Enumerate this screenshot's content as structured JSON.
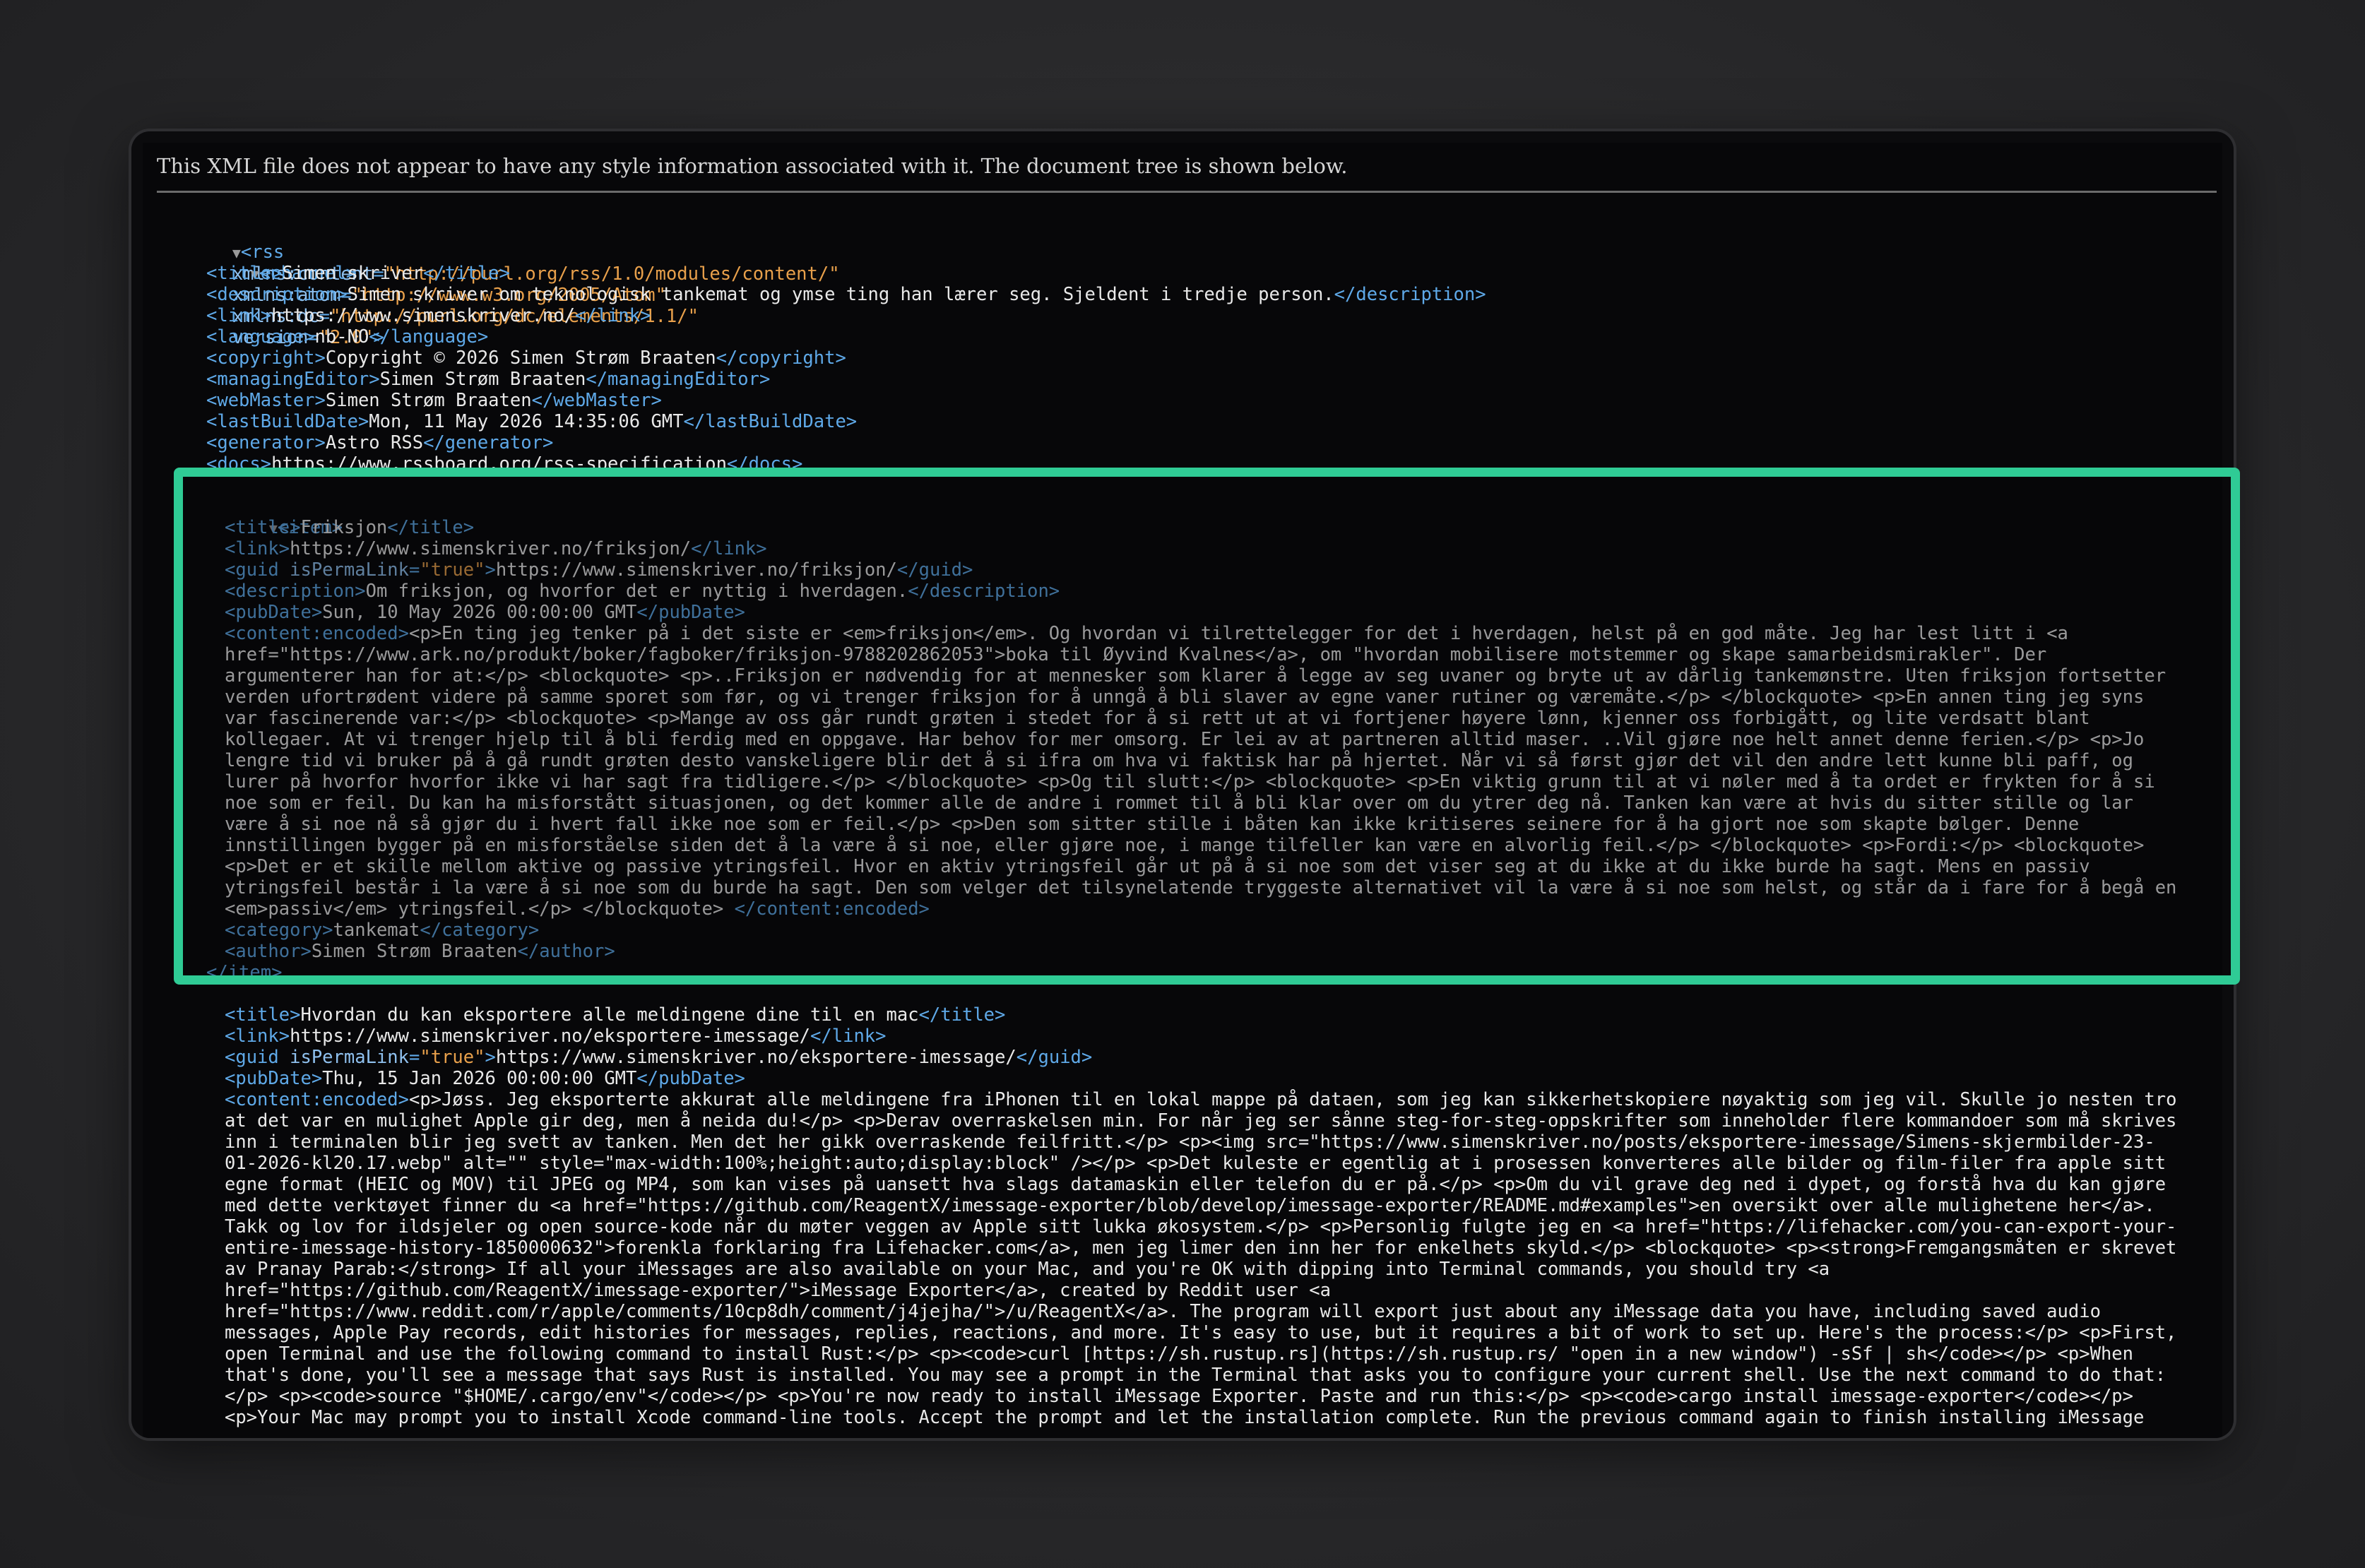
{
  "notice": "This XML file does not appear to have any style information associated with it. The document tree is shown below.",
  "rss": {
    "open_tag": "<rss",
    "attrs": [
      {
        "name": "xmlns:content",
        "value": "\"http://purl.org/rss/1.0/modules/content/\""
      },
      {
        "name": "xmlns:atom",
        "value": "\"http://www.w3.org/2005/Atom\""
      },
      {
        "name": "xmlns:dc",
        "value": "\"http://purl.org/dc/elements/1.1/\""
      },
      {
        "name": "version",
        "value": "\"2.0\""
      }
    ],
    "close": ">"
  },
  "channel_tag": "<channel>",
  "channel": [
    {
      "open": "<title>",
      "text": "Simen skriver",
      "close": "</title>"
    },
    {
      "open": "<description>",
      "text": "Simen skriver om teknologisk tankemat og ymse ting han lærer seg. Sjeldent i tredje person.",
      "close": "</description>"
    },
    {
      "open": "<link>",
      "text": "https://www.simenskriver.no/",
      "close": "</link>"
    },
    {
      "open": "<language>",
      "text": "nb-NO",
      "close": "</language>"
    },
    {
      "open": "<copyright>",
      "text": "Copyright © 2026 Simen Strøm Braaten",
      "close": "</copyright>"
    },
    {
      "open": "<managingEditor>",
      "text": "Simen Strøm Braaten",
      "close": "</managingEditor>"
    },
    {
      "open": "<webMaster>",
      "text": "Simen Strøm Braaten",
      "close": "</webMaster>"
    },
    {
      "open": "<lastBuildDate>",
      "text": "Mon, 11 May 2026 14:35:06 GMT",
      "close": "</lastBuildDate>"
    },
    {
      "open": "<generator>",
      "text": "Astro RSS",
      "close": "</generator>"
    },
    {
      "open": "<docs>",
      "text": "https://www.rssboard.org/rss-specification",
      "close": "</docs>"
    }
  ],
  "item1": {
    "open_tag": "<item>",
    "close_tag": "</item>",
    "title": {
      "open": "<title>",
      "text": "Friksjon",
      "close": "</title>"
    },
    "link": {
      "open": "<link>",
      "text": "https://www.simenskriver.no/friksjon/",
      "close": "</link>"
    },
    "guid": {
      "open": "<guid",
      "attr": "isPermaLink",
      "attr_value": "\"true\"",
      "open_end": ">",
      "text": "https://www.simenskriver.no/friksjon/",
      "close": "</guid>"
    },
    "description": {
      "open": "<description>",
      "text": "Om friksjon, og hvorfor det er nyttig i hverdagen.",
      "close": "</description>"
    },
    "pubDate": {
      "open": "<pubDate>",
      "text": "Sun, 10 May 2026 00:00:00 GMT",
      "close": "</pubDate>"
    },
    "content_open": "<content:encoded>",
    "content_close": "</content:encoded>",
    "content_lines": [
      "<p>En ting jeg tenker på i det siste er <em>friksjon</em>. Og hvordan vi tilrettelegger for det i hverdagen, helst på en god måte. Jeg har lest litt i <a",
      "href=\"https://www.ark.no/produkt/boker/fagboker/friksjon-9788202862053\">boka til Øyvind Kvalnes</a>, om \"hvordan mobilisere motstemmer og skape samarbeidsmirakler\". Der",
      "argumenterer han for at:</p> <blockquote> <p>..Friksjon er nødvendig for at mennesker som klarer å legge av seg uvaner og bryte ut av dårlig tankemønstre. Uten friksjon fortsetter",
      "verden ufortrødent videre på samme sporet som før, og vi trenger friksjon for å unngå å bli slaver av egne vaner rutiner og væremåte.</p> </blockquote> <p>En annen ting jeg syns",
      "var fascinerende var:</p> <blockquote> <p>Mange av oss går rundt grøten i stedet for å si rett ut at vi fortjener høyere lønn, kjenner oss forbigått, og lite verdsatt blant",
      "kollegaer. At vi trenger hjelp til å bli ferdig med en oppgave. Har behov for mer omsorg. Er lei av at partneren alltid maser. ..Vil gjøre noe helt annet denne ferien.</p> <p>Jo",
      "lengre tid vi bruker på å gå rundt grøten desto vanskeligere blir det å si ifra om hva vi faktisk har på hjertet. Når vi så først gjør det vil den andre lett kunne bli paff, og",
      "lurer på hvorfor hvorfor ikke vi har sagt fra tidligere.</p> </blockquote> <p>Og til slutt:</p> <blockquote> <p>En viktig grunn til at vi nøler med å ta ordet er frykten for å si",
      "noe som er feil. Du kan ha misforstått situasjonen, og det kommer alle de andre i rommet til å bli klar over om du ytrer deg nå. Tanken kan være at hvis du sitter stille og lar",
      "være å si noe nå så gjør du i hvert fall ikke noe som er feil.</p> <p>Den som sitter stille i båten kan ikke kritiseres seinere for å ha gjort noe som skapte bølger. Denne",
      "innstillingen bygger på en misforståelse siden det å la være å si noe, eller gjøre noe, i mange tilfeller kan være en alvorlig feil.</p> </blockquote> <p>Fordi:</p> <blockquote>",
      "<p>Det er et skille mellom aktive og passive ytringsfeil. Hvor en aktiv ytringsfeil går ut på å si noe som det viser seg at du ikke at du ikke burde ha sagt. Mens en passiv",
      "ytringsfeil består i la være å si noe som du burde ha sagt. Den som velger det tilsynelatende tryggeste alternativet vil la være å si noe som helst, og står da i fare for å begå en",
      "<em>passiv</em> ytringsfeil.</p> </blockquote> "
    ],
    "category": {
      "open": "<category>",
      "text": "tankemat",
      "close": "</category>"
    },
    "author": {
      "open": "<author>",
      "text": "Simen Strøm Braaten",
      "close": "</author>"
    }
  },
  "item2": {
    "title": {
      "open": "<title>",
      "text": "Hvordan du kan eksportere alle meldingene dine til en mac",
      "close": "</title>"
    },
    "link": {
      "open": "<link>",
      "text": "https://www.simenskriver.no/eksportere-imessage/",
      "close": "</link>"
    },
    "guid": {
      "open": "<guid",
      "attr": "isPermaLink",
      "attr_value": "\"true\"",
      "open_end": ">",
      "text": "https://www.simenskriver.no/eksportere-imessage/",
      "close": "</guid>"
    },
    "pubDate": {
      "open": "<pubDate>",
      "text": "Thu, 15 Jan 2026 00:00:00 GMT",
      "close": "</pubDate>"
    },
    "content_open": "<content:encoded>",
    "content_lines": [
      "<p>Jøss. Jeg eksporterte akkurat alle meldingene fra iPhonen til en lokal mappe på dataen, som jeg kan sikkerhetskopiere nøyaktig som jeg vil. Skulle jo nesten tro",
      "at det var en mulighet Apple gir deg, men å neida du!</p> <p>Derav overraskelsen min. For når jeg ser sånne steg-for-steg-oppskrifter som inneholder flere kommandoer som må skrives",
      "inn i terminalen blir jeg svett av tanken. Men det her gikk overraskende feilfritt.</p> <p><img src=\"https://www.simenskriver.no/posts/eksportere-imessage/Simens-skjermbilder-23-",
      "01-2026-kl20.17.webp\" alt=\"\" style=\"max-width:100%;height:auto;display:block\" /></p> <p>Det kuleste er egentlig at i prosessen konverteres alle bilder og film-filer fra apple sitt",
      "egne format (HEIC og MOV) til JPEG og MP4, som kan vises på uansett hva slags datamaskin eller telefon du er på.</p> <p>Om du vil grave deg ned i dypet, og forstå hva du kan gjøre",
      "med dette verktøyet finner du <a href=\"https://github.com/ReagentX/imessage-exporter/blob/develop/imessage-exporter/README.md#examples\">en oversikt over alle mulighetene her</a>.",
      "Takk og lov for ildsjeler og open source-kode når du møter veggen av Apple sitt lukka økosystem.</p> <p>Personlig fulgte jeg en <a href=\"https://lifehacker.com/you-can-export-your-",
      "entire-imessage-history-1850000632\">forenkla forklaring fra Lifehacker.com</a>, men jeg limer den inn her for enkelhets skyld.</p> <blockquote> <p><strong>Fremgangsmåten er skrevet",
      "av Pranay Parab:</strong> If all your iMessages are also available on your Mac, and you're OK with dipping into Terminal commands, you should try <a",
      "href=\"https://github.com/ReagentX/imessage-exporter/\">iMessage Exporter</a>, created by Reddit user <a",
      "href=\"https://www.reddit.com/r/apple/comments/10cp8dh/comment/j4jejha/\">/u/ReagentX</a>. The program will export just about any iMessage data you have, including saved audio",
      "messages, Apple Pay records, edit histories for messages, replies, reactions, and more. It's easy to use, but it requires a bit of work to set up. Here's the process:</p> <p>First,",
      "open Terminal and use the following command to install Rust:</p> <p><code>curl [https://sh.rustup.rs](https://sh.rustup.rs/ \"open in a new window\") -sSf | sh</code></p> <p>When",
      "that's done, you'll see a message that says Rust is installed. You may see a prompt in the Terminal that asks you to configure your current shell. Use the next command to do that:",
      "</p> <p><code>source \"$HOME/.cargo/env\"</code></p> <p>You're now ready to install iMessage Exporter. Paste and run this:</p> <p><code>cargo install imessage-exporter</code></p>",
      "<p>Your Mac may prompt you to install Xcode command-line tools. Accept the prompt and let the installation complete. Run the previous command again to finish installing iMessage"
    ]
  }
}
